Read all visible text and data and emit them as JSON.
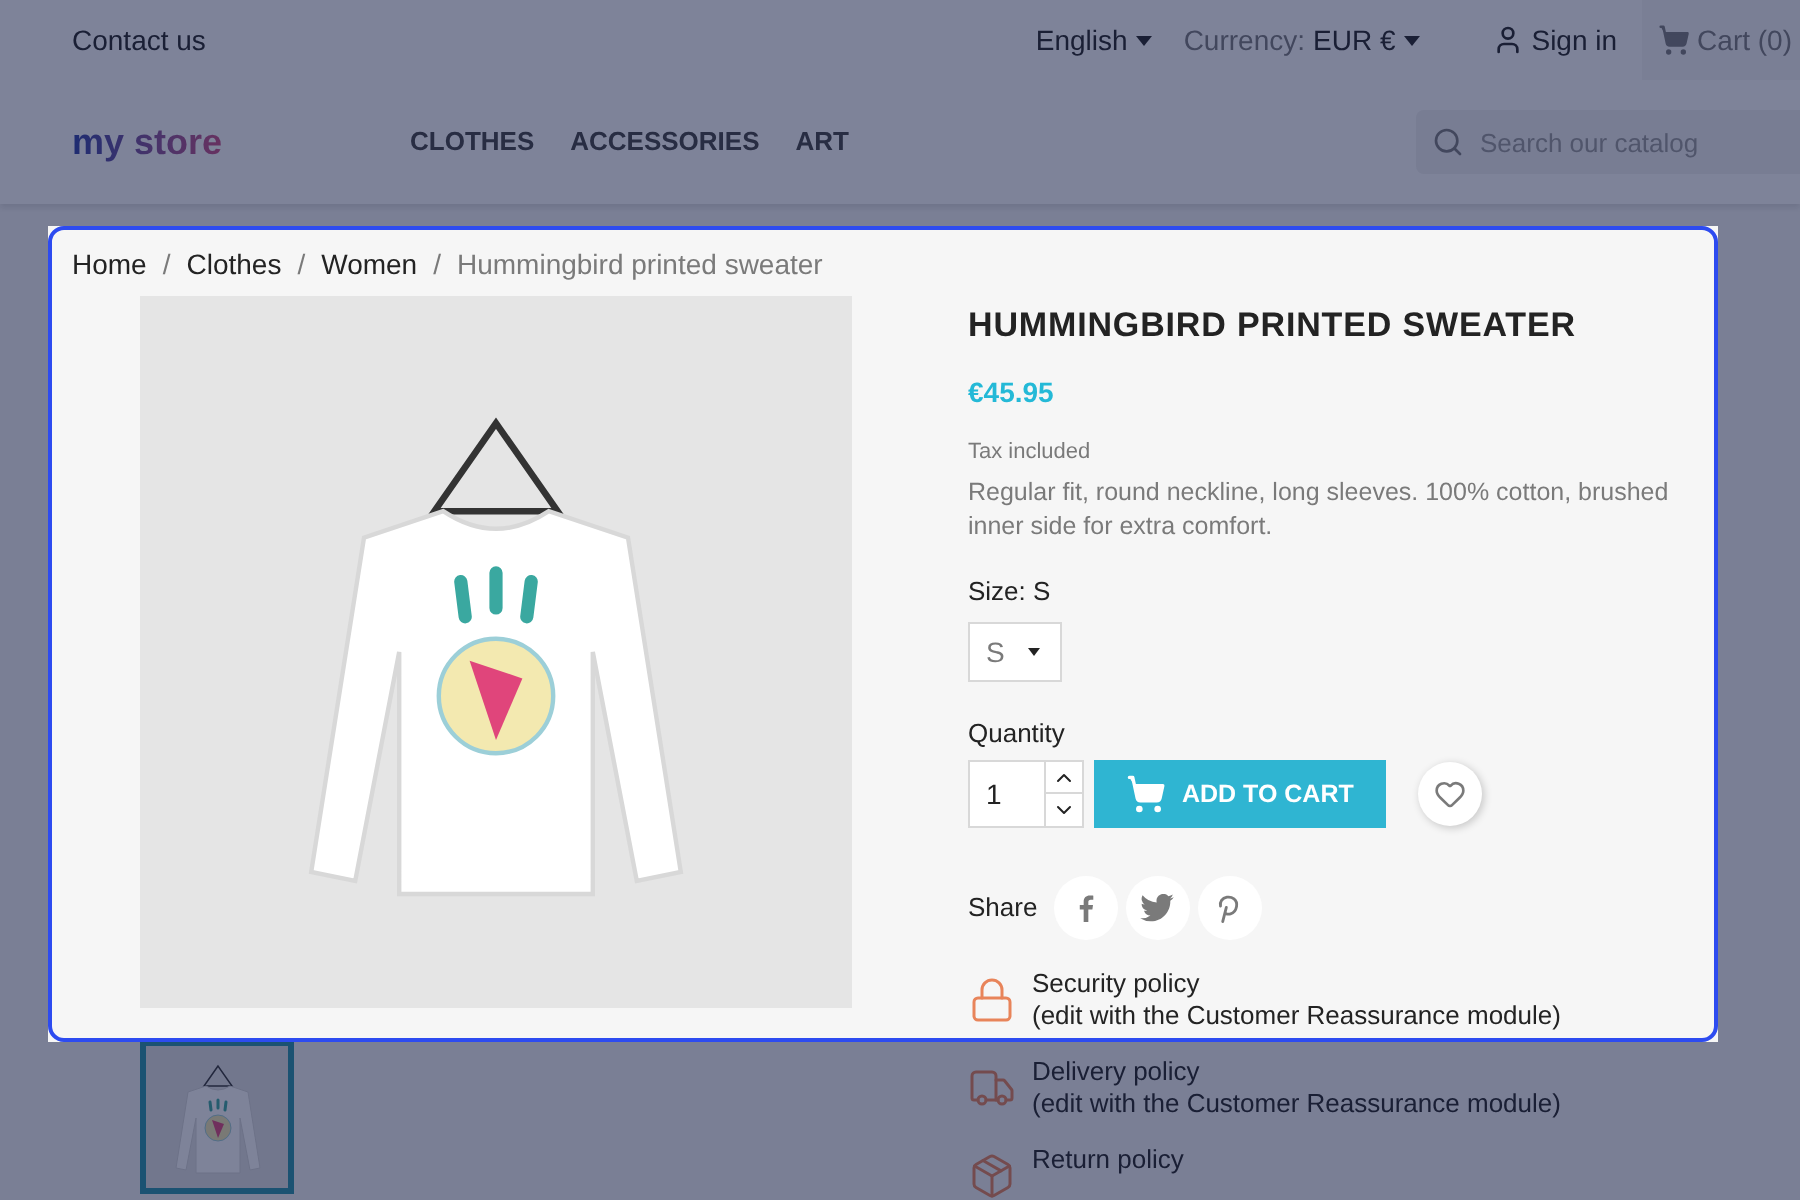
{
  "top_bar": {
    "contact": "Contact us",
    "language": "English",
    "currency_label": "Currency:",
    "currency_value": "EUR €",
    "sign_in": "Sign in",
    "cart": "Cart (0)"
  },
  "header": {
    "logo": "my store",
    "nav": [
      "CLOTHES",
      "ACCESSORIES",
      "ART"
    ],
    "search": {
      "placeholder": "Search our catalog"
    }
  },
  "breadcrumb": [
    {
      "kind": "link",
      "label": "Home"
    },
    {
      "kind": "separator",
      "label": "/"
    },
    {
      "kind": "link",
      "label": "Clothes"
    },
    {
      "kind": "separator",
      "label": "/"
    },
    {
      "kind": "link",
      "label": "Women"
    },
    {
      "kind": "separator",
      "label": "/"
    },
    {
      "kind": "current",
      "label": "Hummingbird printed sweater"
    }
  ],
  "product": {
    "title": "HUMMINGBIRD PRINTED SWEATER",
    "price": "€45.95",
    "tax_note": "Tax included",
    "description": "Regular fit, round neckline, long sleeves. 100% cotton, brushed inner side for extra comfort.",
    "size_label": "Size: S",
    "size_value": "S",
    "quantity_label": "Quantity",
    "quantity": "1",
    "add_to_cart": "ADD TO CART",
    "share_label": "Share"
  },
  "thumbnails": [
    {
      "selected": true
    }
  ],
  "reassurance": [
    {
      "kind": "security",
      "title": "Security policy",
      "note": "(edit with the Customer Reassurance module)"
    },
    {
      "kind": "delivery",
      "title": "Delivery policy",
      "note": "(edit with the Customer Reassurance module)"
    },
    {
      "kind": "return",
      "title": "Return policy"
    }
  ]
}
